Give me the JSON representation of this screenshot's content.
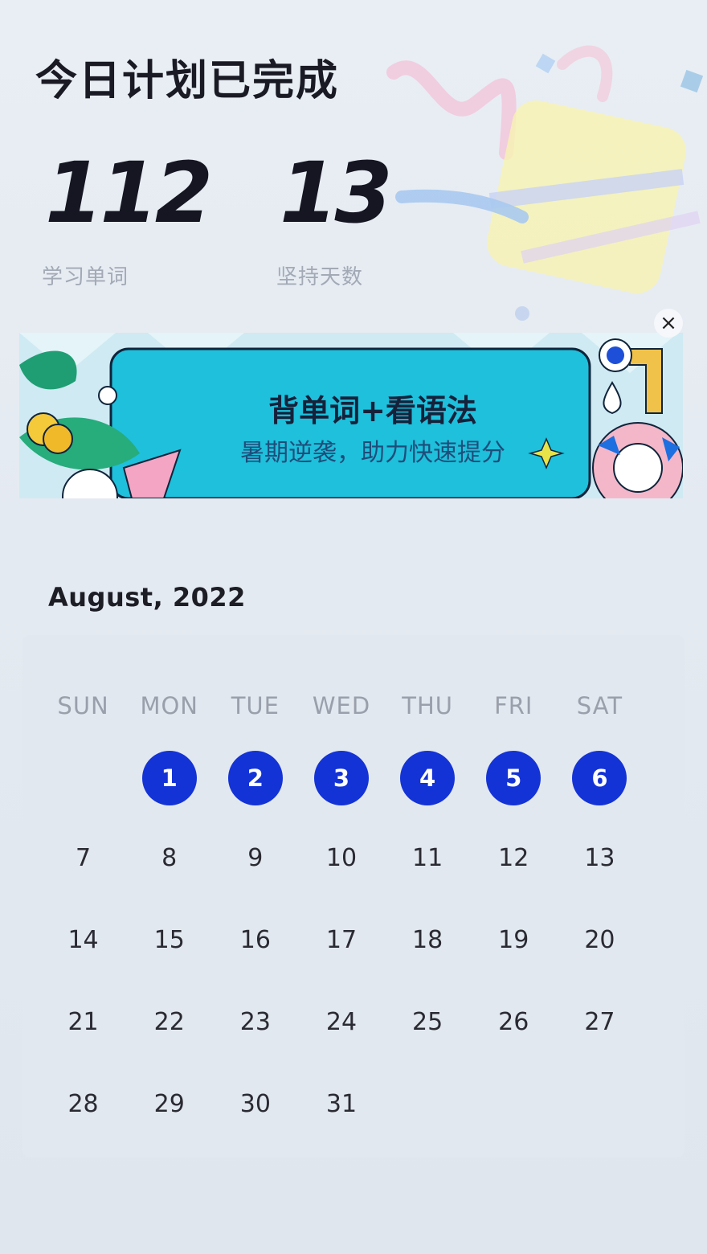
{
  "header": {
    "title": "今日计划已完成"
  },
  "stats": [
    {
      "value": "112",
      "label": "学习单词"
    },
    {
      "value": "13",
      "label": "坚持天数"
    }
  ],
  "banner": {
    "title": "背单词+看语法",
    "subtitle": "暑期逆袭，助力快速提分",
    "close_label": "×"
  },
  "calendar": {
    "month_title": "August, 2022",
    "weekdays": [
      "SUN",
      "MON",
      "TUE",
      "WED",
      "THU",
      "FRI",
      "SAT"
    ],
    "first_weekday_index": 1,
    "days": [
      "1",
      "2",
      "3",
      "4",
      "5",
      "6",
      "7",
      "8",
      "9",
      "10",
      "11",
      "12",
      "13",
      "14",
      "15",
      "16",
      "17",
      "18",
      "19",
      "20",
      "21",
      "22",
      "23",
      "24",
      "25",
      "26",
      "27",
      "28",
      "29",
      "30",
      "31"
    ],
    "completed_days": [
      "1",
      "2",
      "3",
      "4",
      "5",
      "6"
    ],
    "completed_color": "#1433d6"
  }
}
